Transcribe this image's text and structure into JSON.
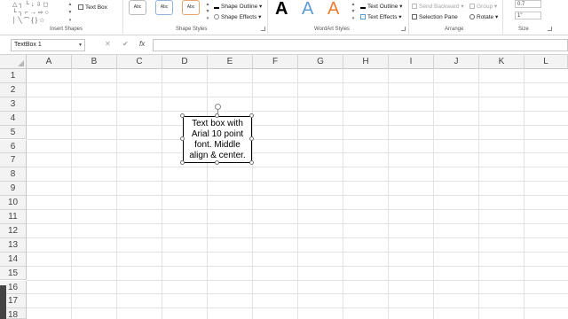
{
  "ribbon": {
    "insert_shapes": {
      "label": "Insert Shapes",
      "glyph_row1": "△ ┐ └ ↓ ⇩ ◻",
      "glyph_row2": "└ ┐ ⌐ → ⇨ ○",
      "glyph_row3": "│ ╲ ⌒ { } ☆",
      "text_box_label": "Text Box"
    },
    "shape_styles": {
      "label": "Shape Styles",
      "tiles": [
        "Abc",
        "Abc",
        "Abc"
      ],
      "shape_outline_label": "Shape Outline",
      "shape_effects_label": "Shape Effects"
    },
    "wordart_styles": {
      "label": "WordArt Styles",
      "letters": [
        "A",
        "A",
        "A"
      ],
      "text_outline_label": "Text Outline",
      "text_effects_label": "Text Effects"
    },
    "arrange": {
      "label": "Arrange",
      "send_backward_label": "Send Backward",
      "group_label": "Group",
      "selection_pane_label": "Selection Pane",
      "rotate_label": "Rotate"
    },
    "size": {
      "label": "Size",
      "height_value": "0.7",
      "width_value": "1\""
    }
  },
  "formula_bar": {
    "name_box_value": "TextBox 1",
    "cancel_glyph": "✕",
    "enter_glyph": "✔",
    "fx_label": "fx",
    "formula_value": ""
  },
  "grid": {
    "columns": [
      "A",
      "B",
      "C",
      "D",
      "E",
      "F",
      "G",
      "H",
      "I",
      "J",
      "K",
      "L"
    ],
    "rows": [
      "1",
      "2",
      "3",
      "4",
      "5",
      "6",
      "7",
      "8",
      "9",
      "10",
      "11",
      "12",
      "13",
      "14",
      "15",
      "16",
      "17",
      "18"
    ]
  },
  "textbox": {
    "text": "Text box with\nArial 10 point\nfont.  Middle\nalign & center."
  },
  "colors": {
    "wordart_black": "#000000",
    "wordart_blue": "#5b9bd5",
    "wordart_orange": "#ed7d31",
    "header_bg": "#f3f3f3",
    "gridline": "#e3e3e3"
  }
}
